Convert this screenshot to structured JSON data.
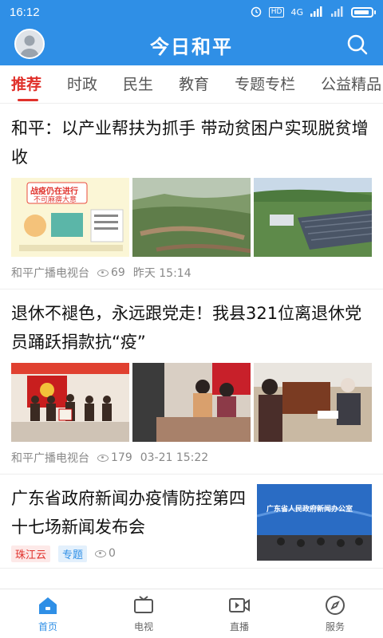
{
  "status": {
    "time": "16:12",
    "net": "4G",
    "hd": "HD"
  },
  "header": {
    "title": "今日和平"
  },
  "tabs": [
    "推荐",
    "时政",
    "民生",
    "教育",
    "专题专栏",
    "公益精品"
  ],
  "articles": [
    {
      "title": "和平：以产业帮扶为抓手 带动贫困户实现脱贫增收",
      "source": "和平广播电视台",
      "views": "69",
      "time": "昨天 15:14",
      "poster_text": [
        "战疫仍在进行",
        "不可麻痹大意"
      ]
    },
    {
      "title": "退休不褪色，永远跟党走！我县321位离退休党员踊跃捐款抗“疫”",
      "source": "和平广播电视台",
      "views": "179",
      "time": "03-21 15:22"
    },
    {
      "title": "广东省政府新闻办疫情防控第四十七场新闻发布会",
      "source": "珠江云",
      "tag": "专题",
      "views": "0",
      "banner_text": "广东省人民政府新闻办公室"
    }
  ],
  "bottom_nav": [
    {
      "label": "首页",
      "icon": "home-icon"
    },
    {
      "label": "电视",
      "icon": "tv-icon"
    },
    {
      "label": "直播",
      "icon": "live-video-icon"
    },
    {
      "label": "服务",
      "icon": "compass-icon"
    }
  ],
  "colors": {
    "primary": "#2f8fe6",
    "accent": "#e0312b"
  }
}
